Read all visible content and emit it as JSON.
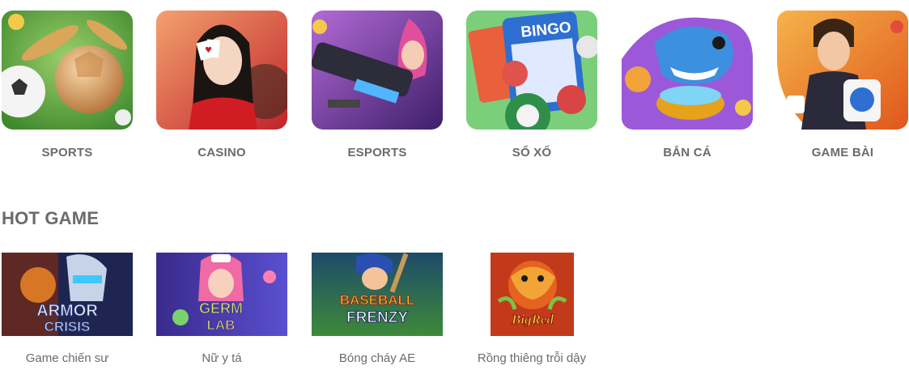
{
  "categories": [
    {
      "label": "SPORTS",
      "icon": "soccer-ball-icon"
    },
    {
      "label": "CASINO",
      "icon": "casino-dealer-icon"
    },
    {
      "label": "ESPORTS",
      "icon": "esports-warrior-icon"
    },
    {
      "label": "SỔ XỐ",
      "icon": "bingo-card-icon",
      "art_text": "BINGO"
    },
    {
      "label": "BẮN CÁ",
      "icon": "shark-fish-icon"
    },
    {
      "label": "GAME BÀI",
      "icon": "card-game-icon"
    }
  ],
  "hot_section": {
    "title": "HOT GAME",
    "games": [
      {
        "label": "Game chiến sư",
        "art_text_1": "ARMOR",
        "art_text_2": "CRISIS"
      },
      {
        "label": "Nữ y tá",
        "art_text_1": "GERM",
        "art_text_2": "LAB"
      },
      {
        "label": "Bóng cháy AE",
        "art_text_1": "BASEBALL",
        "art_text_2": "FRENZY"
      },
      {
        "label": "Rồng thiêng trỗi dậy",
        "art_text_1": "BigRed"
      }
    ]
  }
}
